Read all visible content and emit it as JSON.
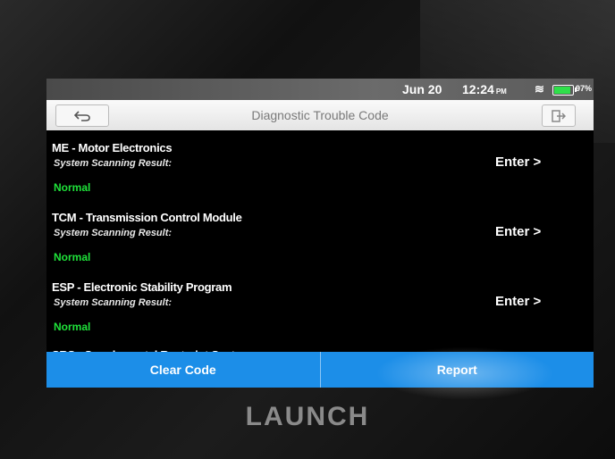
{
  "statusbar": {
    "date": "Jun 20",
    "time": "12:24",
    "ampm": "PM",
    "battery_pct": "97%",
    "battery_level": 0.97
  },
  "titlebar": {
    "title": "Diagnostic Trouble Code"
  },
  "items": [
    {
      "name": "ME - Motor Electronics",
      "sub": "System Scanning Result:",
      "status": "Normal",
      "action": "Enter >"
    },
    {
      "name": "TCM - Transmission Control Module",
      "sub": "System Scanning Result:",
      "status": "Normal",
      "action": "Enter >"
    },
    {
      "name": "ESP - Electronic Stability Program",
      "sub": "System Scanning Result:",
      "status": "Normal",
      "action": "Enter >"
    },
    {
      "name": "SRS - Supplemental Restraint System"
    }
  ],
  "actions": {
    "clear_code": "Clear Code",
    "report": "Report"
  },
  "device": {
    "brand": "LAUNCH"
  },
  "colors": {
    "status_ok": "#1fe23a",
    "action_bar": "#1c8ee8"
  },
  "icons": [
    "back-arrow-icon",
    "exit-icon",
    "wifi-icon",
    "battery-icon"
  ]
}
